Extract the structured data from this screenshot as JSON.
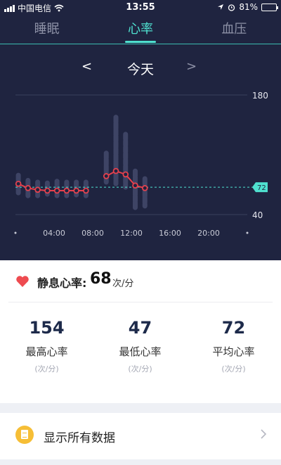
{
  "status_bar": {
    "carrier": "中国电信",
    "time": "13:55",
    "battery": "81%"
  },
  "tabs": [
    {
      "label": "睡眠",
      "active": false
    },
    {
      "label": "心率",
      "active": true
    },
    {
      "label": "血压",
      "active": false
    }
  ],
  "date_nav": {
    "prev": "<",
    "label": "今天",
    "next": ">"
  },
  "colors": {
    "header_bg": "#1f2440",
    "accent": "#4fe0cf",
    "line": "#e5414d",
    "bars": "#3e4465"
  },
  "chart_data": {
    "type": "line",
    "x_ticks": [
      "04:00",
      "08:00",
      "12:00",
      "16:00",
      "20:00"
    ],
    "y_ticks": [
      180,
      40
    ],
    "ylim": [
      40,
      180
    ],
    "reference_line": {
      "value": 72,
      "label": "72"
    },
    "series": [
      {
        "segment": "overnight",
        "points": [
          [
            0.3,
            76
          ],
          [
            1.3,
            71
          ],
          [
            2.3,
            69
          ],
          [
            3.3,
            68
          ],
          [
            4.3,
            68
          ],
          [
            5.3,
            68
          ],
          [
            6.3,
            68
          ],
          [
            7.3,
            68
          ]
        ]
      },
      {
        "segment": "daytime",
        "points": [
          [
            9.4,
            85
          ],
          [
            10.4,
            91
          ],
          [
            11.4,
            87
          ],
          [
            12.4,
            74
          ],
          [
            13.4,
            71
          ]
        ]
      }
    ],
    "range_bars": [
      [
        0.3,
        64,
        86
      ],
      [
        1.3,
        62,
        80
      ],
      [
        2.3,
        62,
        78
      ],
      [
        3.3,
        63,
        77
      ],
      [
        4.3,
        62,
        79
      ],
      [
        5.3,
        62,
        78
      ],
      [
        6.3,
        63,
        78
      ],
      [
        7.3,
        62,
        78
      ],
      [
        9.4,
        78,
        112
      ],
      [
        10.4,
        76,
        154
      ],
      [
        11.4,
        72,
        134
      ],
      [
        12.4,
        47,
        91
      ],
      [
        13.4,
        50,
        82
      ]
    ]
  },
  "resting": {
    "label": "静息心率:",
    "value": "68",
    "unit": "次/分"
  },
  "stats": [
    {
      "value": "154",
      "name": "最高心率",
      "unit": "(次/分)"
    },
    {
      "value": "47",
      "name": "最低心率",
      "unit": "(次/分)"
    },
    {
      "value": "72",
      "name": "平均心率",
      "unit": "(次/分)"
    }
  ],
  "show_all": {
    "label": "显示所有数据",
    "icon": "document-icon"
  }
}
